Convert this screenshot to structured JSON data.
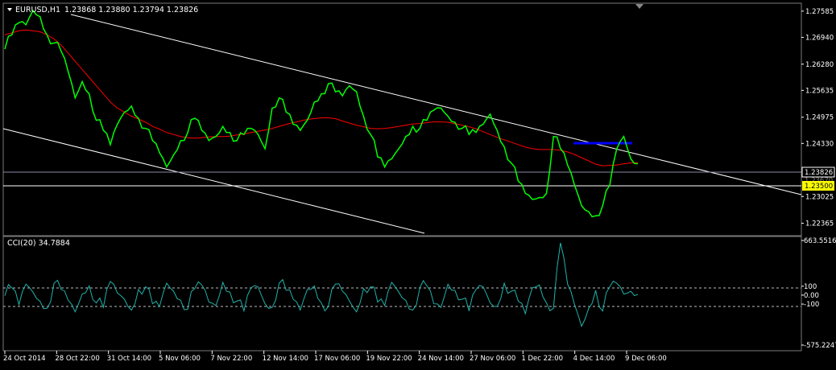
{
  "main_panel": {
    "symbol_label": "EURUSD,H1",
    "ohlc": "1.23868 1.23880 1.23794 1.23826",
    "price_axis_labels": [
      "1.27585",
      "1.26940",
      "1.26280",
      "1.25635",
      "1.24975",
      "1.24330",
      "1.23025",
      "1.22365"
    ],
    "current_price_label": "1.23826",
    "hidden_price_label": "1.23670",
    "horizontal_line_label": "1.23500"
  },
  "cci_panel": {
    "title": "CCI(20) 34.7884",
    "axis_labels": [
      "663.5516",
      "100",
      "0.00",
      "-100",
      "-575.2247"
    ]
  },
  "time_axis": {
    "labels": [
      "24 Oct 2014",
      "28 Oct 22:00",
      "31 Oct 14:00",
      "5 Nov 06:00",
      "7 Nov 22:00",
      "12 Nov 14:00",
      "17 Nov 06:00",
      "19 Nov 22:00",
      "24 Nov 14:00",
      "27 Nov 06:00",
      "1 Dec 22:00",
      "4 Dec 14:00",
      "9 Dec 06:00"
    ]
  },
  "colors": {
    "price_line": "#00ff00",
    "moving_average": "#ff0000",
    "channel_lines": "#ffffff",
    "resistance_line": "#0000ff",
    "cci_line": "#20b2aa",
    "highlight_label_bg": "#ffff00"
  },
  "chart_data": [
    {
      "type": "line",
      "series": [
        {
          "values": [
            1.2665,
            1.27,
            1.273,
            1.2725,
            1.276,
            1.2745,
            1.27,
            1.268,
            1.266,
            1.261,
            1.2545,
            1.2585,
            1.2555,
            1.249,
            1.2465,
            1.243,
            1.248,
            1.251,
            1.2525,
            1.2495,
            1.247,
            1.244,
            1.241,
            1.2375,
            1.2405,
            1.244,
            1.246,
            1.2495,
            1.2465,
            1.244,
            1.245,
            1.2475,
            1.246,
            1.244,
            1.2455,
            1.247,
            1.2455,
            1.242,
            1.252,
            1.2545,
            1.251,
            1.248,
            1.2465,
            1.249,
            1.2535,
            1.2555,
            1.258,
            1.256,
            1.255,
            1.2575,
            1.256,
            1.25,
            1.2455,
            1.24,
            1.2375,
            1.2395,
            1.242,
            1.245,
            1.2475,
            1.247,
            1.249,
            1.2515,
            1.252,
            1.25,
            1.2485,
            1.247,
            1.2455,
            1.246,
            1.248,
            1.2505,
            1.2465,
            1.2425,
            1.2385,
            1.234,
            1.231,
            1.2295,
            1.23,
            1.231,
            1.245,
            1.242,
            1.238,
            1.233,
            1.228,
            1.2265,
            1.2255,
            1.228,
            1.233,
            1.242,
            1.245,
            1.2395,
            1.2383
          ]
        },
        {
          "values": [
            1.27,
            1.2705,
            1.271,
            1.2712,
            1.271,
            1.2708,
            1.27,
            1.269,
            1.2675,
            1.2655,
            1.2635,
            1.2615,
            1.2595,
            1.2575,
            1.2555,
            1.2535,
            1.252,
            1.251,
            1.25,
            1.2493,
            1.2485,
            1.2475,
            1.2468,
            1.246,
            1.2455,
            1.245,
            1.2447,
            1.2446,
            1.2447,
            1.2449,
            1.245,
            1.245,
            1.2451,
            1.2454,
            1.2456,
            1.246,
            1.2463,
            1.2466,
            1.247,
            1.2475,
            1.248,
            1.2484,
            1.2488,
            1.2492,
            1.2494,
            1.2496,
            1.2496,
            1.2494,
            1.2488,
            1.2483,
            1.2478,
            1.2474,
            1.247,
            1.2469,
            1.247,
            1.2472,
            1.2475,
            1.2478,
            1.2481,
            1.2482,
            1.2484,
            1.2486,
            1.2486,
            1.2485,
            1.2482,
            1.2478,
            1.2474,
            1.2469,
            1.2462,
            1.2455,
            1.2448,
            1.2442,
            1.2436,
            1.243,
            1.2424,
            1.242,
            1.2418,
            1.2418,
            1.2418,
            1.2416,
            1.2412,
            1.2406,
            1.2398,
            1.239,
            1.2382,
            1.2378,
            1.2379,
            1.238,
            1.2383,
            1.2385,
            1.2386
          ]
        }
      ],
      "ylim": [
        1.221,
        1.2774
      ]
    },
    {
      "type": "line",
      "series": [
        {
          "values": [
            20,
            110,
            -80,
            150,
            60,
            -40,
            -120,
            160,
            90,
            -30,
            -160,
            40,
            130,
            -60,
            -110,
            180,
            50,
            -20,
            -140,
            90,
            120,
            -70,
            -100,
            160,
            70,
            -30,
            -130,
            100,
            140,
            -50,
            -90,
            170,
            60,
            -40,
            -150,
            110,
            120,
            -70,
            -110,
            160,
            80,
            -20,
            -140,
            90,
            130,
            -60,
            -100,
            150,
            70,
            -40,
            -160,
            100,
            120,
            -50,
            -90,
            170,
            60,
            -30,
            -140,
            110,
            130,
            -70,
            -110,
            150,
            80,
            -20,
            -150,
            90,
            120,
            -60,
            -100,
            160,
            70,
            -40,
            -180,
            110,
            140,
            -60,
            -120,
            610,
            150,
            -80,
            -320,
            -120,
            80,
            -150,
            120,
            160,
            40,
            70,
            34.8
          ]
        }
      ],
      "ylim": [
        -575.2247,
        663.5516
      ]
    }
  ]
}
